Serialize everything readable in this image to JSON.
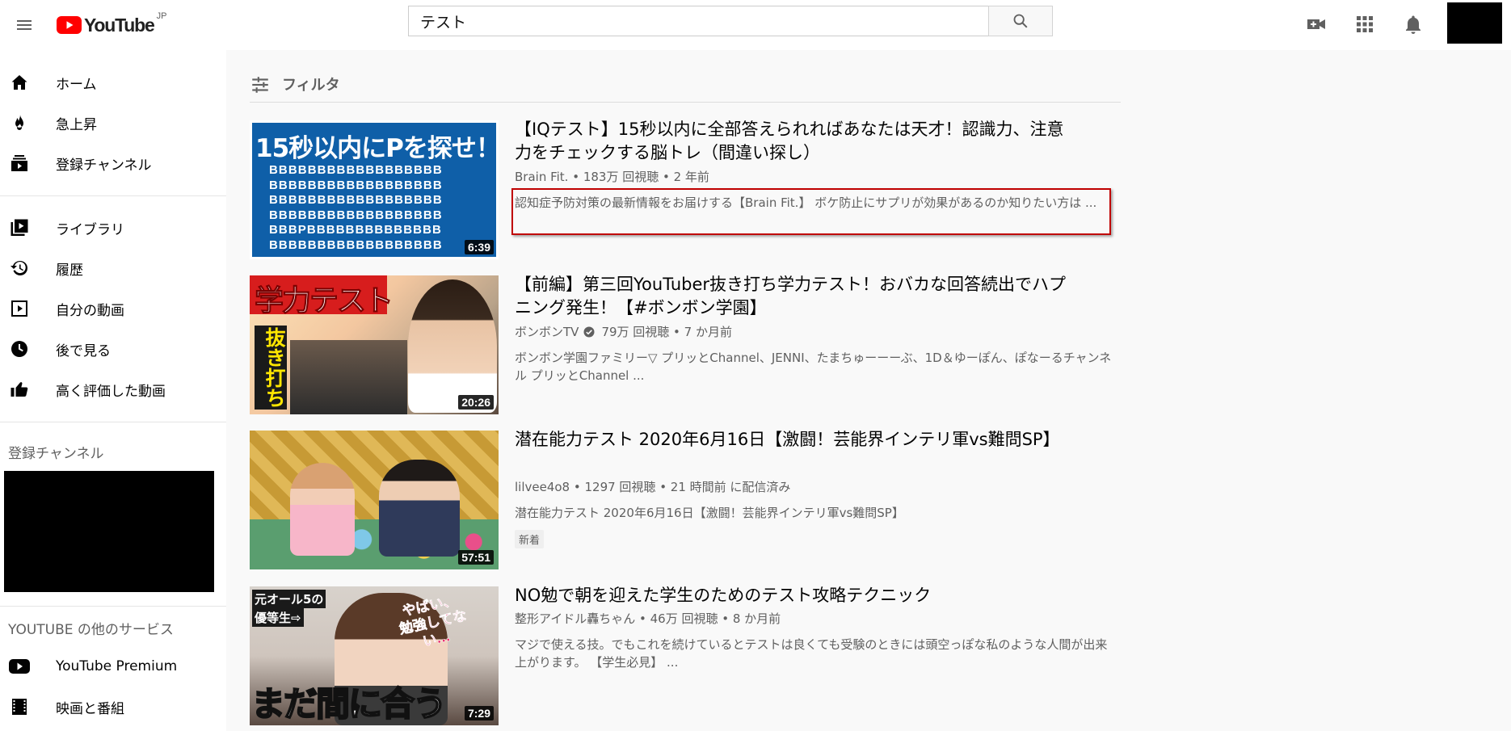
{
  "header": {
    "logo_text": "YouTube",
    "logo_region": "JP",
    "search": {
      "value": "テスト"
    }
  },
  "sidebar": {
    "primary": [
      {
        "label": "ホーム",
        "icon": "home-icon"
      },
      {
        "label": "急上昇",
        "icon": "fire-icon"
      },
      {
        "label": "登録チャンネル",
        "icon": "subscriptions-icon"
      }
    ],
    "library": [
      {
        "label": "ライブラリ",
        "icon": "library-icon"
      },
      {
        "label": "履歴",
        "icon": "history-icon"
      },
      {
        "label": "自分の動画",
        "icon": "my-videos-icon"
      },
      {
        "label": "後で見る",
        "icon": "watch-later-icon"
      },
      {
        "label": "高く評価した動画",
        "icon": "thumbs-up-icon"
      }
    ],
    "subscriptions_title": "登録チャンネル",
    "more_services_title": "YOUTUBE の他のサービス",
    "more_services": [
      {
        "label": "YouTube Premium",
        "icon": "youtube-icon"
      },
      {
        "label": "映画と番組",
        "icon": "film-icon"
      }
    ]
  },
  "filter": {
    "label": "フィルタ"
  },
  "results": [
    {
      "title": "【IQテスト】15秒以内に全部答えられればあなたは天才！認識力、注意力をチェックする脳トレ（間違い探し）",
      "meta": "Brain Fit. • 183万 回視聴 • 2 年前",
      "description": "認知症予防対策の最新情報をお届けする【Brain Fit.】 ボケ防止にサプリが効果があるのか知りたい方は ...",
      "duration": "6:39",
      "thumb_text": "15秒以内にPを探せ！",
      "thumb_rows": [
        "BBBBBBBBBBBBBBBBBB",
        "BBBBBBBBBBBBBBBBBB",
        "BBBBBBBBBBBBBBBBBB",
        "BBBBBBBBBBBBBBBBBB",
        "BBBPBBBBBBBBBBBBBB",
        "BBBBBBBBBBBBBBBBBB"
      ]
    },
    {
      "title": "【前編】第三回YouTuber抜き打ち学力テスト！おバカな回答続出でハプニング発生！【#ボンボン学園】",
      "channel": "ボンボンTV",
      "meta_rest": "79万 回視聴 • 7 か月前",
      "description": "ボンボン学園ファミリー▽ プリッとChannel、JENNI、たまちゅーーーぶ、1D＆ゆーぽん、ぽなーるチャンネル プリッとChannel ...",
      "duration": "20:26",
      "thumb_text": "学力テスト",
      "thumb_sub": "抜き打ち"
    },
    {
      "title": "潜在能力テスト 2020年6月16日【激闘！芸能界インテリ軍vs難問SP】",
      "meta": "lilvee4o8 • 1297 回視聴 • 21 時間前 に配信済み",
      "description": "潜在能力テスト 2020年6月16日【激闘！芸能界インテリ軍vs難問SP】",
      "badge": "新着",
      "duration": "57:51"
    },
    {
      "title": "NO勉で朝を迎えた学生のためのテスト攻略テクニック",
      "meta": "整形アイドル轟ちゃん • 46万 回視聴 • 8 か月前",
      "description": "マジで使える技。でもこれを続けているとテストは良くても受験のときには頭空っぽな私のような人間が出来上がります。 【学生必見】 ...",
      "duration": "7:29",
      "thumb_text": "まだ間に合う",
      "thumb_caption_1": "元オール5の",
      "thumb_caption_2": "優等生⇨",
      "thumb_bubble_1": "やばい、",
      "thumb_bubble_2": "勉強してない…"
    }
  ]
}
